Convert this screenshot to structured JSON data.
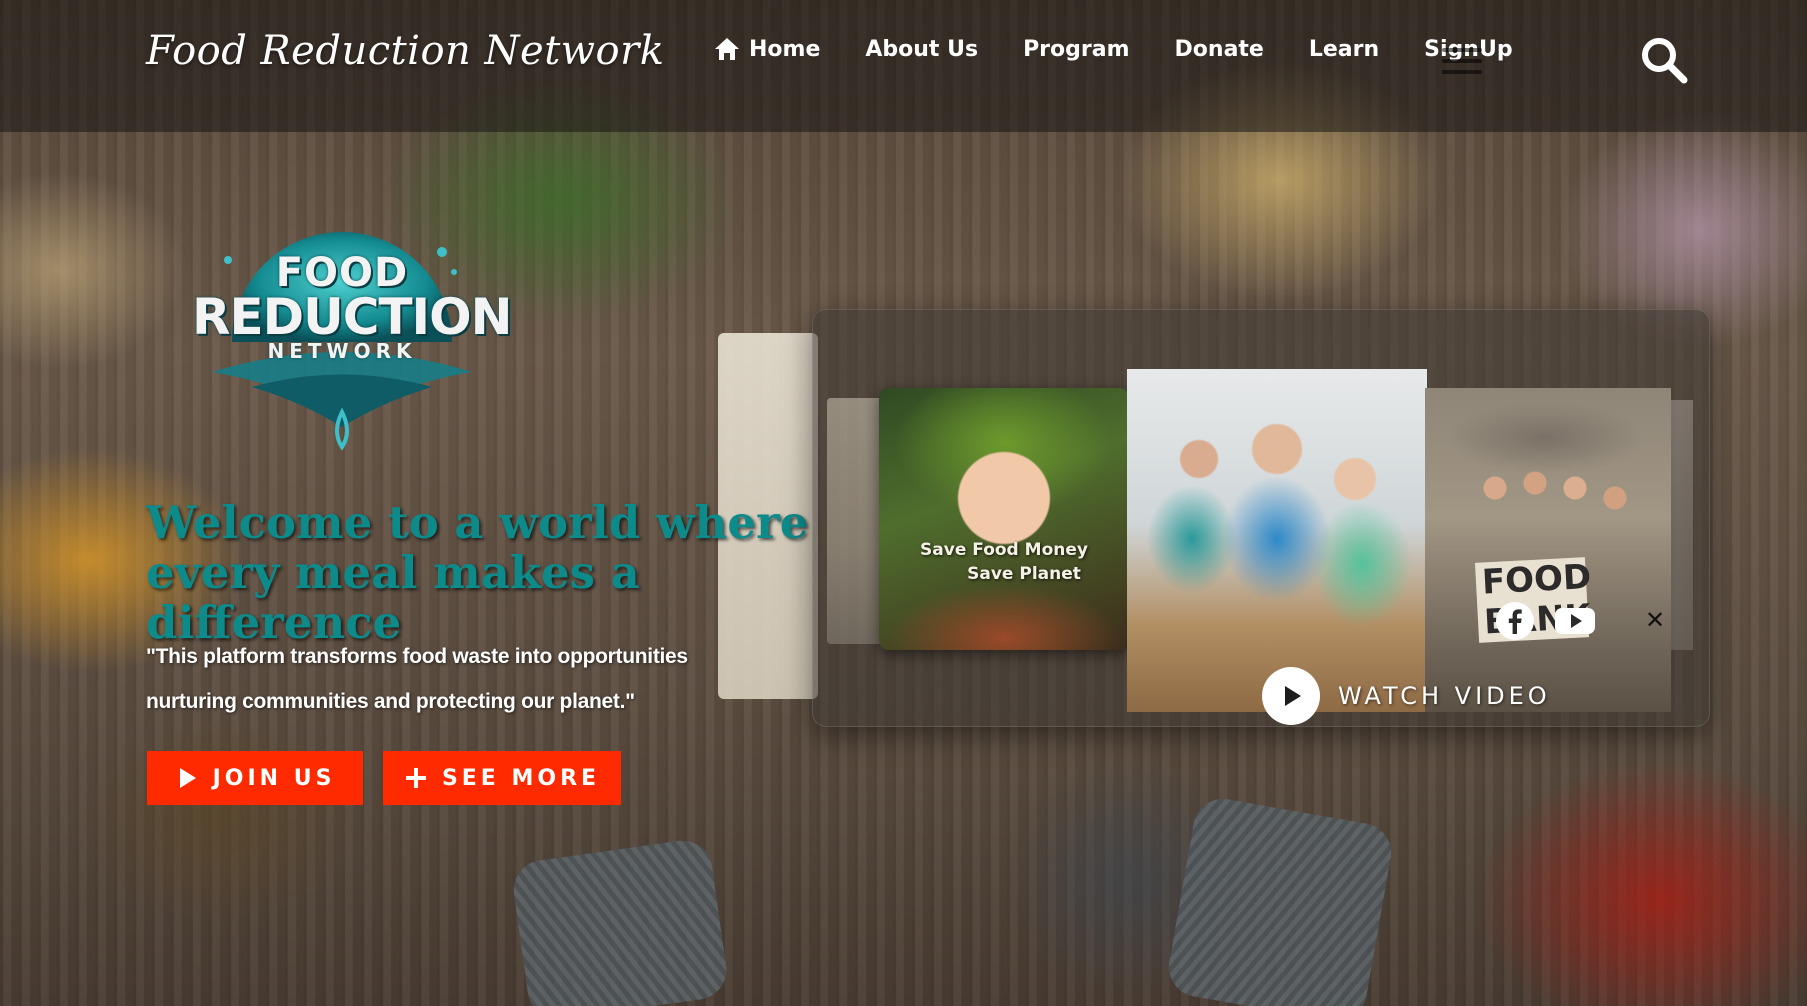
{
  "header": {
    "brand": "Food Reduction Network",
    "nav": [
      {
        "label": "Home",
        "icon": "home-icon"
      },
      {
        "label": "About Us"
      },
      {
        "label": "Program"
      },
      {
        "label": "Donate"
      },
      {
        "label": "Learn"
      },
      {
        "label": "SignUp"
      }
    ],
    "search_icon": "search-icon",
    "menu_icon": "hamburger-icon"
  },
  "hero": {
    "logo": {
      "line1": "FOOD",
      "line2": "REDUCTION",
      "line3": "NETWORK"
    },
    "headline": "Welcome to a world where every meal makes a difference",
    "quote": "\"This platform transforms food waste into opportunities nurturing communities and protecting our planet.\"",
    "buttons": {
      "join": "JOIN US",
      "more": "SEE MORE"
    }
  },
  "gallery": {
    "card1_caption_line1": "Save Food Money",
    "card1_caption_line2": "Save Planet",
    "card3_sign": "FOOD\nBANK",
    "watch_label": "WATCH VIDEO",
    "social": [
      "facebook-icon",
      "youtube-icon"
    ],
    "close": "✕"
  },
  "colors": {
    "accent": "#ff2a00",
    "headline": "#0d8b8b",
    "header_bg": "#19161480"
  }
}
